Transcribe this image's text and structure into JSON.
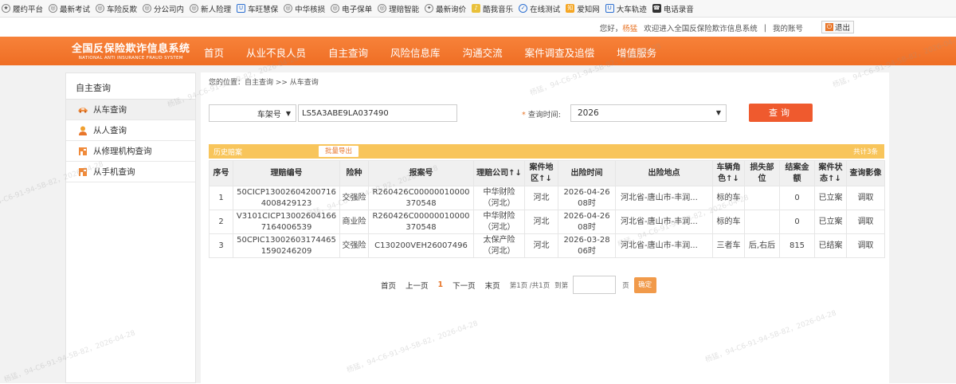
{
  "bookmarks": [
    {
      "icon": "star-icon",
      "label": "履约平台"
    },
    {
      "icon": "globe-icon",
      "label": "最新考试"
    },
    {
      "icon": "globe-icon",
      "label": "车险反欺"
    },
    {
      "icon": "globe-icon",
      "label": "分公司内"
    },
    {
      "icon": "globe-icon",
      "label": "新人险理"
    },
    {
      "icon": "shield-icon",
      "label": "车旺慧保"
    },
    {
      "icon": "globe-icon",
      "label": "中华核损"
    },
    {
      "icon": "globe-icon",
      "label": "电子保单"
    },
    {
      "icon": "globe-icon",
      "label": "理赔智能"
    },
    {
      "icon": "bird-icon",
      "label": "最新询价"
    },
    {
      "icon": "music-icon",
      "label": "酷我音乐"
    },
    {
      "icon": "check-icon",
      "label": "在线测试"
    },
    {
      "icon": "knowledge-icon",
      "label": "爱知网"
    },
    {
      "icon": "shield-icon",
      "label": "大车轨迹"
    },
    {
      "icon": "phone-icon",
      "label": "电话录音"
    }
  ],
  "topbar": {
    "greeting": "您好，",
    "username": "杨猛",
    "welcome": "欢迎进入全国反保险欺诈信息系统",
    "my_account": "我的账号",
    "logout": "退出"
  },
  "logo": {
    "cn": "全国反保险欺诈信息系统",
    "en": "NATIONAL ANTI INSURANCE FRAUD SYSTEM"
  },
  "nav": [
    "首页",
    "从业不良人员",
    "自主查询",
    "风险信息库",
    "沟通交流",
    "案件调查及追偿",
    "增值服务"
  ],
  "sidebar": {
    "title": "自主查询",
    "items": [
      {
        "label": "从车查询",
        "icon": "car-icon"
      },
      {
        "label": "从人查询",
        "icon": "person-icon"
      },
      {
        "label": "从修理机构查询",
        "icon": "repair-shop-icon"
      },
      {
        "label": "从手机查询",
        "icon": "phone-icon"
      }
    ]
  },
  "breadcrumb": "您的位置：自主查询 >> 从车查询",
  "search": {
    "type_value": "车架号",
    "vin_value": "LS5A3ABE9LA037490",
    "time_label": "查询时间:",
    "year_value": "2026",
    "query_label": "查询"
  },
  "panel": {
    "title": "历史赔案",
    "export_label": "批量导出",
    "total": "共计3条"
  },
  "table": {
    "headers": [
      "序号",
      "理赔编号",
      "险种",
      "报案号",
      "理赔公司↑↓",
      "案件地区↑↓",
      "出险时间",
      "出险地点",
      "车辆角色↑↓",
      "损失部位",
      "结案金额",
      "案件状态↑↓",
      "查询影像"
    ],
    "rows": [
      [
        "1",
        "50CICP130026042007164008429123",
        "交强险",
        "R260426C00000010000370548",
        "中华财险（河北）",
        "河北",
        "2026-04-26 08时",
        "河北省-唐山市-丰润...",
        "标的车",
        "",
        "0",
        "已立案",
        "调取"
      ],
      [
        "2",
        "V3101CICP130026041667164006539",
        "商业险",
        "R260426C00000010000370548",
        "中华财险（河北）",
        "河北",
        "2026-04-26 08时",
        "河北省-唐山市-丰润...",
        "标的车",
        "",
        "0",
        "已立案",
        "调取"
      ],
      [
        "3",
        "50CPIC130026031744651590246209",
        "交强险",
        "C130200VEH26007496",
        "太保产险（河北）",
        "河北",
        "2026-03-28 06时",
        "河北省-唐山市-丰润...",
        "三者车",
        "后,右后",
        "815",
        "已结案",
        "调取"
      ]
    ]
  },
  "pager": {
    "first": "首页",
    "prev": "上一页",
    "current": "1",
    "next": "下一页",
    "last": "末页",
    "info": "第1页 /共1页",
    "goto": "到第",
    "page_unit": "页",
    "confirm": "确定"
  },
  "watermark": "杨猛，94-C6-91-94-5B-82，2026-04-28",
  "colors": {
    "nav_orange": "#f07a30",
    "panel_yellow": "#f8c55b",
    "query_button": "#ef5a2e",
    "accent": "#e8762a"
  }
}
